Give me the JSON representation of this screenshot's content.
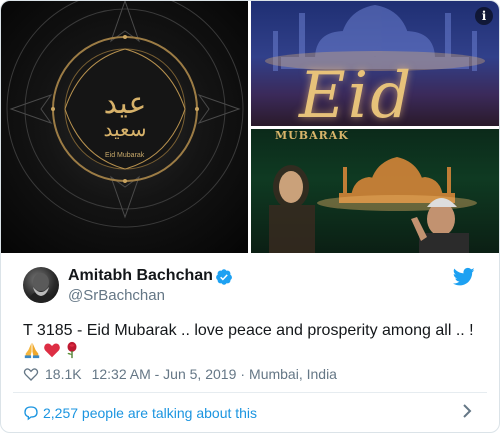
{
  "media": {
    "tile1": {
      "label": "Eid Mubarak"
    },
    "tile2": {
      "script_text": "Eid"
    },
    "tile3": {
      "top_text": "MUBARAK"
    },
    "info_icon": "i"
  },
  "author": {
    "name": "Amitabh Bachchan",
    "handle": "@SrBachchan",
    "verified": true
  },
  "tweet": {
    "text": "T 3185 - Eid Mubarak .. love peace and prosperity among all .. !",
    "emojis": [
      "folded-hands",
      "red-heart",
      "rose"
    ]
  },
  "meta": {
    "likes": "18.1K",
    "time": "12:32 AM - Jun 5, 2019",
    "separator": "·",
    "location": "Mumbai, India"
  },
  "footer": {
    "talking": "2,257 people are talking about this"
  },
  "colors": {
    "twitter_blue": "#1da1f2",
    "link_blue": "#1b95e0",
    "text": "#14171a",
    "secondary": "#657786"
  }
}
